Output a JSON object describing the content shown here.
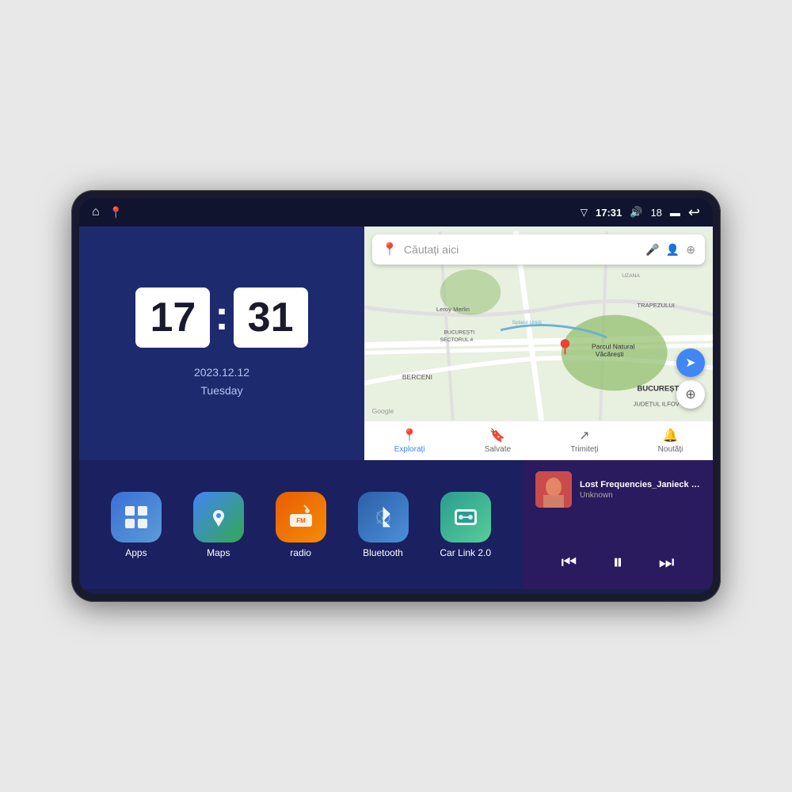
{
  "device": {
    "status_bar": {
      "left_icons": [
        "home-icon",
        "maps-icon"
      ],
      "time": "17:31",
      "volume_icon": "🔊",
      "battery_level": "18",
      "battery_icon": "battery-icon",
      "back_icon": "↩"
    },
    "clock": {
      "hours": "17",
      "minutes": "31",
      "date": "2023.12.12",
      "day": "Tuesday"
    },
    "map": {
      "search_placeholder": "Căutați aici",
      "nav_items": [
        {
          "label": "Explorați",
          "active": true
        },
        {
          "label": "Salvate",
          "active": false
        },
        {
          "label": "Trimiteți",
          "active": false
        },
        {
          "label": "Noutăți",
          "active": false
        }
      ],
      "places": [
        "Parcul Natural Văcărești",
        "Leroy Merlin",
        "BUCUREȘTI SECTORUL 4",
        "BERCENI",
        "BUCUREȘTI",
        "JUDEȚUL ILFOV",
        "TRAPEZULUI",
        "Splaiul Unirii",
        "Google"
      ]
    },
    "apps": [
      {
        "label": "Apps",
        "icon_class": "icon-apps",
        "icon": "⊞"
      },
      {
        "label": "Maps",
        "icon_class": "icon-maps",
        "icon": "📍"
      },
      {
        "label": "radio",
        "icon_class": "icon-radio",
        "icon": "📻"
      },
      {
        "label": "Bluetooth",
        "icon_class": "icon-bluetooth",
        "icon": "⧖"
      },
      {
        "label": "Car Link 2.0",
        "icon_class": "icon-carlink",
        "icon": "🔗"
      }
    ],
    "music": {
      "title": "Lost Frequencies_Janieck Devy-...",
      "artist": "Unknown",
      "controls": {
        "prev": "⏮",
        "play": "⏸",
        "next": "⏭"
      }
    }
  }
}
